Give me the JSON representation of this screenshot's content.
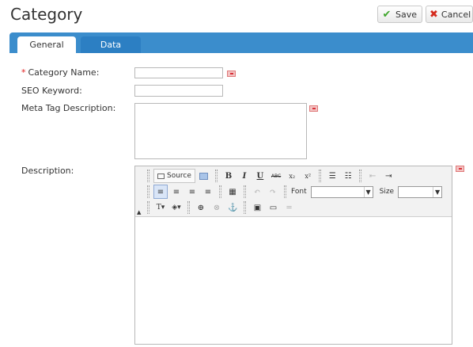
{
  "header": {
    "title": "Category",
    "save_label": "Save",
    "cancel_label": "Cancel"
  },
  "tabs": [
    {
      "label": "General",
      "active": true
    },
    {
      "label": "Data",
      "active": false
    }
  ],
  "form": {
    "required_marker": "*",
    "category_name_label": "Category Name:",
    "category_name_value": "",
    "seo_keyword_label": "SEO Keyword:",
    "seo_keyword_value": "",
    "meta_description_label": "Meta Tag Description:",
    "meta_description_value": "",
    "description_label": "Description:"
  },
  "editor": {
    "source_label": "Source",
    "font_label": "Font",
    "size_label": "Size",
    "font_value": "",
    "size_value": "",
    "bold_glyph": "B",
    "italic_glyph": "I",
    "underline_glyph": "U",
    "strike_glyph": "ABC",
    "subscript_glyph": "x₂",
    "superscript_glyph": "x²"
  },
  "colors": {
    "tab_bar": "#3b8dcc",
    "active_tab": "#ffffff",
    "inactive_tab": "#2c7fc3",
    "required": "#e02020"
  }
}
